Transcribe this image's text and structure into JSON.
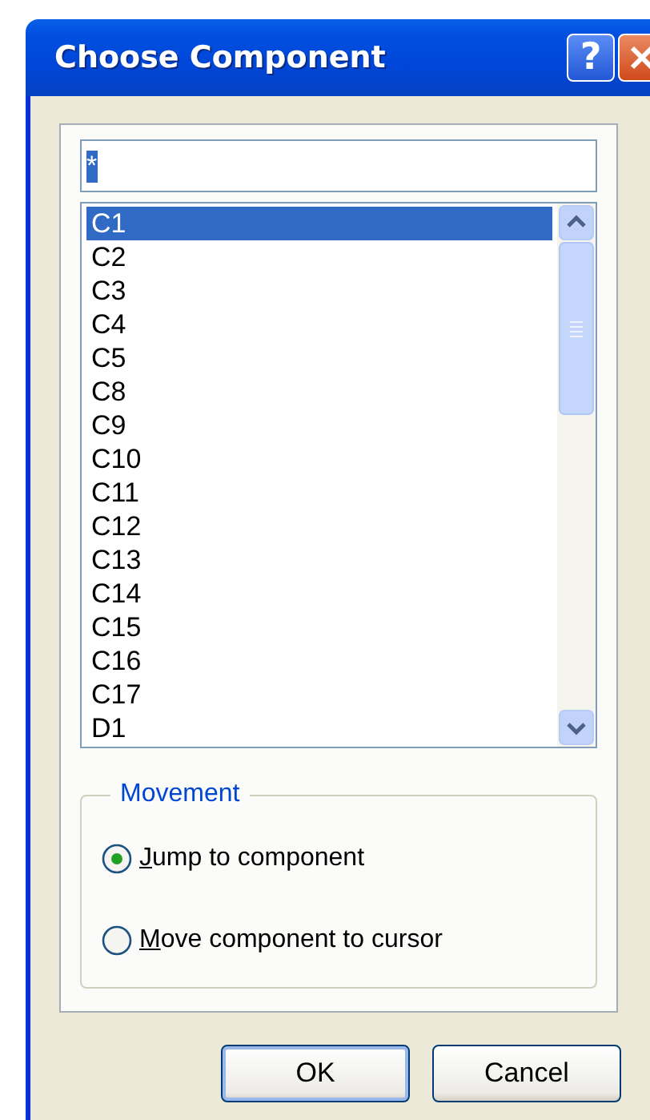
{
  "window": {
    "title": "Choose Component",
    "title_buttons": [
      {
        "kind": "help",
        "label": "?"
      },
      {
        "kind": "close"
      }
    ]
  },
  "filter": {
    "value": "*",
    "text_selected": true
  },
  "list": {
    "items": [
      {
        "label": "C1",
        "selected": true
      },
      {
        "label": "C2",
        "selected": false
      },
      {
        "label": "C3",
        "selected": false
      },
      {
        "label": "C4",
        "selected": false
      },
      {
        "label": "C5",
        "selected": false
      },
      {
        "label": "C8",
        "selected": false
      },
      {
        "label": "C9",
        "selected": false
      },
      {
        "label": "C10",
        "selected": false
      },
      {
        "label": "C11",
        "selected": false
      },
      {
        "label": "C12",
        "selected": false
      },
      {
        "label": "C13",
        "selected": false
      },
      {
        "label": "C14",
        "selected": false
      },
      {
        "label": "C15",
        "selected": false
      },
      {
        "label": "C16",
        "selected": false
      },
      {
        "label": "C17",
        "selected": false
      },
      {
        "label": "D1",
        "selected": false
      }
    ]
  },
  "movement": {
    "legend": "Movement",
    "options": [
      {
        "label": "Jump to component",
        "selected": true,
        "access_key": true
      },
      {
        "label": "Move component to cursor",
        "selected": false,
        "access_key": true
      }
    ]
  },
  "buttons": [
    {
      "label": "OK",
      "default": true
    },
    {
      "label": "Cancel",
      "default": false
    }
  ]
}
